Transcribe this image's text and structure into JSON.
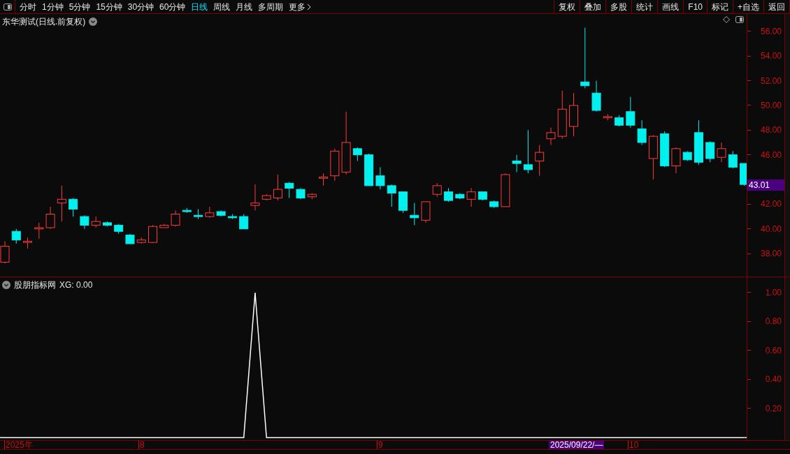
{
  "toolbar": {
    "periods": [
      {
        "label": "分时",
        "selected": false
      },
      {
        "label": "1分钟",
        "selected": false
      },
      {
        "label": "5分钟",
        "selected": false
      },
      {
        "label": "15分钟",
        "selected": false
      },
      {
        "label": "30分钟",
        "selected": false
      },
      {
        "label": "60分钟",
        "selected": false
      },
      {
        "label": "日线",
        "selected": true
      },
      {
        "label": "周线",
        "selected": false
      },
      {
        "label": "月线",
        "selected": false
      },
      {
        "label": "多周期",
        "selected": false
      },
      {
        "label": "更多",
        "selected": false
      }
    ],
    "actions": [
      "复权",
      "叠加",
      "多股",
      "统计",
      "画线",
      "F10",
      "标记",
      "+自选",
      "返回"
    ]
  },
  "main_chart": {
    "title": "东华测试(日线.前复权)",
    "current_price": "43.01",
    "chart_data": {
      "type": "candlestick",
      "ylim": [
        36.08,
        57.41
      ],
      "yticks": [
        {
          "value": 56,
          "label": "56.00"
        },
        {
          "value": 54,
          "label": "54.00"
        },
        {
          "value": 52,
          "label": "52.00"
        },
        {
          "value": 50,
          "label": "50.00"
        },
        {
          "value": 48,
          "label": "48.00"
        },
        {
          "value": 46,
          "label": "46.00"
        },
        {
          "value": 42,
          "label": "42.00"
        },
        {
          "value": 40,
          "label": "40.00"
        },
        {
          "value": 38,
          "label": "38.00"
        }
      ],
      "ohlc": [
        [
          37.3,
          39,
          37.2,
          38.6
        ],
        [
          39.8,
          40,
          38.8,
          39.1
        ],
        [
          38.9,
          39.3,
          38.4,
          39.0
        ],
        [
          40.0,
          40.5,
          39.2,
          40.1
        ],
        [
          40.1,
          41.8,
          40,
          41.2
        ],
        [
          42.1,
          43.5,
          40.6,
          42.4
        ],
        [
          42.4,
          42.5,
          41,
          41.6
        ],
        [
          41,
          41.1,
          40,
          40.3
        ],
        [
          40.3,
          41,
          40.1,
          40.6
        ],
        [
          40.5,
          40.6,
          40.2,
          40.3
        ],
        [
          40.3,
          40.4,
          39.6,
          39.8
        ],
        [
          39.5,
          39.6,
          38.8,
          38.8
        ],
        [
          38.9,
          39.3,
          38.8,
          39.1
        ],
        [
          38.9,
          40.3,
          38.85,
          40.2
        ],
        [
          40.1,
          40.4,
          40.1,
          40.3
        ],
        [
          40.3,
          41.5,
          40.2,
          41.2
        ],
        [
          41.5,
          41.7,
          41.3,
          41.4
        ],
        [
          41.1,
          41.6,
          40.8,
          41.0
        ],
        [
          41.0,
          41.8,
          40.9,
          41.3
        ],
        [
          41.4,
          41.5,
          41.0,
          41.1
        ],
        [
          41.0,
          41.2,
          40.8,
          40.9
        ],
        [
          41.0,
          41.2,
          40.0,
          40.0
        ],
        [
          41.9,
          43.6,
          41.5,
          42.1
        ],
        [
          42.4,
          42.8,
          42.3,
          42.7
        ],
        [
          42.5,
          44.4,
          42.3,
          43.2
        ],
        [
          43.7,
          43.8,
          42.5,
          43.3
        ],
        [
          43.2,
          43.3,
          42.4,
          42.5
        ],
        [
          42.6,
          42.9,
          42.4,
          42.8
        ],
        [
          44.1,
          44.5,
          43.5,
          44.2
        ],
        [
          44.3,
          46.5,
          43.9,
          46.3
        ],
        [
          44.6,
          49.5,
          44.4,
          47.0
        ],
        [
          46.5,
          46.6,
          45.5,
          46.0
        ],
        [
          46.0,
          46.1,
          43.5,
          43.5
        ],
        [
          44.3,
          45.0,
          43.2,
          43.5
        ],
        [
          43.5,
          43.6,
          41.8,
          42.9
        ],
        [
          43.0,
          43.0,
          41.3,
          41.5
        ],
        [
          41.1,
          42.1,
          40.3,
          40.9
        ],
        [
          40.7,
          42.2,
          40.5,
          42.2
        ],
        [
          42.8,
          43.7,
          42.6,
          43.5
        ],
        [
          43.0,
          43.3,
          42.2,
          42.3
        ],
        [
          42.8,
          42.9,
          42.4,
          42.5
        ],
        [
          42.4,
          43.3,
          41.8,
          43.0
        ],
        [
          43.0,
          43.0,
          42.3,
          42.4
        ],
        [
          42.2,
          42.3,
          41.7,
          41.8
        ],
        [
          41.8,
          44.5,
          41.8,
          44.4
        ],
        [
          45.5,
          46.0,
          44.6,
          45.3
        ],
        [
          45.2,
          48.0,
          44.5,
          44.8
        ],
        [
          45.5,
          46.8,
          44.3,
          46.2
        ],
        [
          47.3,
          48.2,
          46.8,
          47.8
        ],
        [
          47.5,
          51.2,
          47.3,
          49.7
        ],
        [
          48.3,
          51.0,
          47.5,
          50.0
        ],
        [
          51.9,
          56.3,
          51.4,
          51.6
        ],
        [
          51.0,
          52.0,
          49.5,
          49.6
        ],
        [
          49.0,
          49.3,
          48.8,
          49.1
        ],
        [
          49.0,
          49.2,
          48.3,
          48.4
        ],
        [
          49.5,
          50.7,
          48.2,
          48.4
        ],
        [
          48.1,
          48.8,
          46.8,
          47.0
        ],
        [
          45.7,
          47.6,
          44.0,
          47.5
        ],
        [
          47.7,
          47.9,
          45.0,
          45.1
        ],
        [
          45.1,
          46.6,
          44.5,
          46.5
        ],
        [
          46.2,
          46.3,
          45.5,
          45.6
        ],
        [
          47.8,
          48.8,
          45.2,
          45.4
        ],
        [
          47.0,
          47.1,
          45.4,
          45.7
        ],
        [
          45.8,
          47.0,
          45.4,
          46.5
        ],
        [
          46.0,
          46.3,
          44.9,
          45.0
        ],
        [
          45.3,
          45.3,
          43.5,
          43.6
        ]
      ]
    }
  },
  "indicator": {
    "title": "股朋指标网",
    "reading": ": 0.00",
    "chart_data": {
      "type": "line",
      "ylim": [
        -0.017,
        1.106
      ],
      "yticks": [
        {
          "value": 0.2,
          "label": "0.20"
        },
        {
          "value": 0.4,
          "label": "0.40"
        },
        {
          "value": 0.6,
          "label": "0.60"
        },
        {
          "value": 0.8,
          "label": "0.80"
        },
        {
          "value": 1.0,
          "label": "1.00"
        }
      ],
      "series": [
        {
          "name": "XG",
          "color": "#ffffff",
          "values": [
            0,
            0,
            0,
            0,
            0,
            0,
            0,
            0,
            0,
            0,
            0,
            0,
            0,
            0,
            0,
            0,
            0,
            0,
            0,
            0,
            0,
            0,
            1,
            0,
            0,
            0,
            0,
            0,
            0,
            0,
            0,
            0,
            0,
            0,
            0,
            0,
            0,
            0,
            0,
            0,
            0,
            0,
            0,
            0,
            0,
            0,
            0,
            0,
            0,
            0,
            0,
            0,
            0,
            0,
            0,
            0,
            0,
            0,
            0,
            0,
            0,
            0,
            0,
            0,
            0,
            0
          ]
        }
      ]
    }
  },
  "date_axis": {
    "labels": [
      "2025年",
      "8",
      "9",
      "10"
    ],
    "cursor_date": "2025/09/22/—"
  }
}
